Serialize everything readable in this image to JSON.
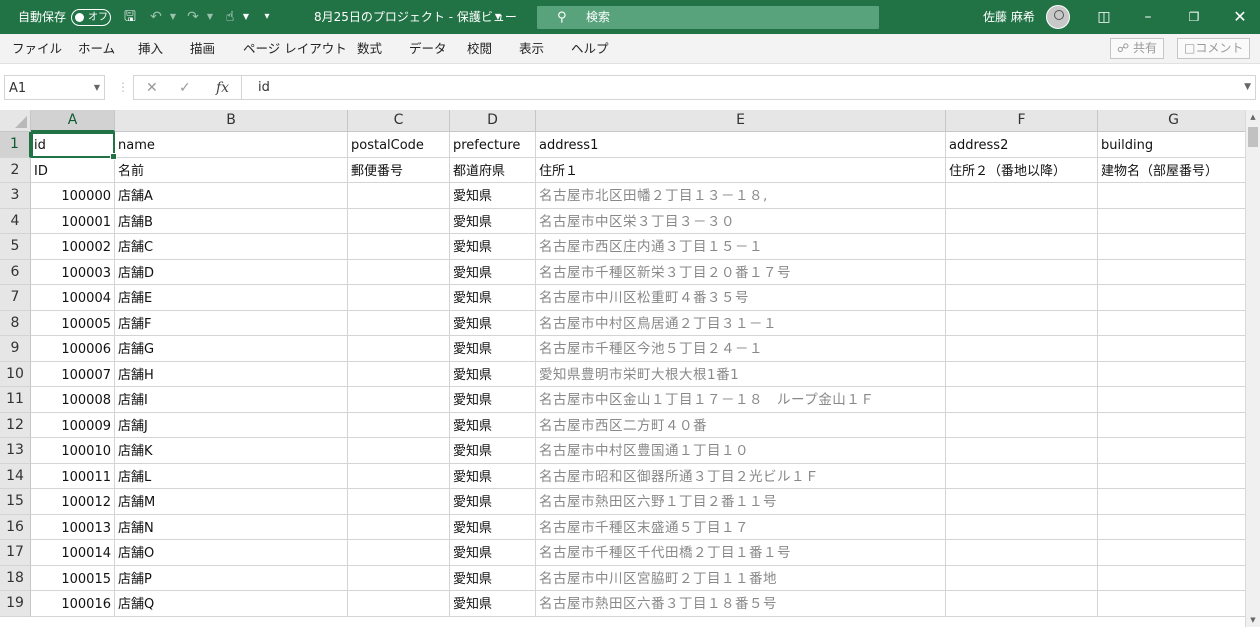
{
  "titlebar": {
    "autosave_label": "自動保存",
    "autosave_state": "オフ",
    "file_title": "8月25日のプロジェクト - 保護ビュー",
    "search_placeholder": "検索",
    "user_name": "佐藤 麻希",
    "accent_color": "#217346"
  },
  "menubar": {
    "items": [
      "ファイル",
      "ホーム",
      "挿入",
      "描画",
      "ページ レイアウト",
      "数式",
      "データ",
      "校閲",
      "表示",
      "ヘルプ"
    ],
    "share_label": "共有",
    "comment_label": "コメント"
  },
  "formula_bar": {
    "name_box": "A1",
    "fx_label": "fx",
    "value": "id"
  },
  "grid": {
    "columns": [
      "A",
      "B",
      "C",
      "D",
      "E",
      "F",
      "G"
    ],
    "active_cell": "A1",
    "rows": [
      {
        "n": "1",
        "cells": [
          "id",
          "name",
          "postalCode",
          "prefecture",
          "address1",
          "address2",
          "building"
        ]
      },
      {
        "n": "2",
        "cells": [
          "ID",
          "名前",
          "郵便番号",
          "都道府県",
          "住所１",
          "住所２（番地以降）",
          "建物名（部屋番号）"
        ]
      },
      {
        "n": "3",
        "cells": [
          "100000",
          "店舗A",
          "",
          "愛知県",
          "名古屋市北区田幡２丁目１３－１８,",
          "",
          ""
        ]
      },
      {
        "n": "4",
        "cells": [
          "100001",
          "店舗B",
          "",
          "愛知県",
          "名古屋市中区栄３丁目３－３０",
          "",
          ""
        ]
      },
      {
        "n": "5",
        "cells": [
          "100002",
          "店舗C",
          "",
          "愛知県",
          "名古屋市西区庄内通３丁目１５－１",
          "",
          ""
        ]
      },
      {
        "n": "6",
        "cells": [
          "100003",
          "店舗D",
          "",
          "愛知県",
          "名古屋市千種区新栄３丁目２０番１７号",
          "",
          ""
        ]
      },
      {
        "n": "7",
        "cells": [
          "100004",
          "店舗E",
          "",
          "愛知県",
          "名古屋市中川区松重町４番３５号",
          "",
          ""
        ]
      },
      {
        "n": "8",
        "cells": [
          "100005",
          "店舗F",
          "",
          "愛知県",
          "名古屋市中村区鳥居通２丁目３１－１",
          "",
          ""
        ]
      },
      {
        "n": "9",
        "cells": [
          "100006",
          "店舗G",
          "",
          "愛知県",
          "名古屋市千種区今池５丁目２４－１",
          "",
          ""
        ]
      },
      {
        "n": "10",
        "cells": [
          "100007",
          "店舗H",
          "",
          "愛知県",
          "愛知県豊明市栄町大根大根1番1",
          "",
          ""
        ]
      },
      {
        "n": "11",
        "cells": [
          "100008",
          "店舗I",
          "",
          "愛知県",
          "名古屋市中区金山１丁目１７－１８　ループ金山１Ｆ",
          "",
          ""
        ]
      },
      {
        "n": "12",
        "cells": [
          "100009",
          "店舗J",
          "",
          "愛知県",
          "名古屋市西区二方町４０番",
          "",
          ""
        ]
      },
      {
        "n": "13",
        "cells": [
          "100010",
          "店舗K",
          "",
          "愛知県",
          "名古屋市中村区豊国通１丁目１０",
          "",
          ""
        ]
      },
      {
        "n": "14",
        "cells": [
          "100011",
          "店舗L",
          "",
          "愛知県",
          "名古屋市昭和区御器所通３丁目２光ビル１Ｆ",
          "",
          ""
        ]
      },
      {
        "n": "15",
        "cells": [
          "100012",
          "店舗M",
          "",
          "愛知県",
          "名古屋市熱田区六野１丁目２番１１号",
          "",
          ""
        ]
      },
      {
        "n": "16",
        "cells": [
          "100013",
          "店舗N",
          "",
          "愛知県",
          "名古屋市千種区末盛通５丁目１７",
          "",
          ""
        ]
      },
      {
        "n": "17",
        "cells": [
          "100014",
          "店舗O",
          "",
          "愛知県",
          "名古屋市千種区千代田橋２丁目１番１号",
          "",
          ""
        ]
      },
      {
        "n": "18",
        "cells": [
          "100015",
          "店舗P",
          "",
          "愛知県",
          "名古屋市中川区宮脇町２丁目１１番地",
          "",
          ""
        ]
      },
      {
        "n": "19",
        "cells": [
          "100016",
          "店舗Q",
          "",
          "愛知県",
          "名古屋市熱田区六番３丁目１８番５号",
          "",
          ""
        ]
      }
    ]
  }
}
